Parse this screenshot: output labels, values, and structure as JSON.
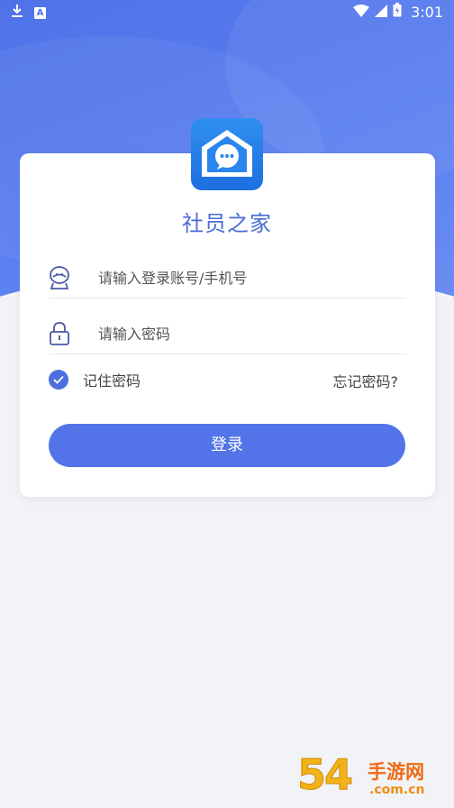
{
  "status_bar": {
    "time": "3:01",
    "icons": [
      "download-icon",
      "a-notification-icon",
      "wifi-icon",
      "signal-icon",
      "battery-icon"
    ]
  },
  "app": {
    "title": "社员之家",
    "logo_icon": "house-chat-bubble-icon"
  },
  "login_form": {
    "account_placeholder": "请输入登录账号/手机号",
    "password_placeholder": "请输入密码",
    "remember_label": "记住密码",
    "remember_checked": true,
    "forgot_label": "忘记密码?",
    "login_label": "登录"
  },
  "watermark": {
    "number": "54",
    "cn": "手游网",
    "domain": ".com.cn"
  },
  "colors": {
    "primary": "#5274E8",
    "hero": "#4F72E8",
    "background": "#F2F3F6",
    "accent_text": "#4B6BD8"
  }
}
